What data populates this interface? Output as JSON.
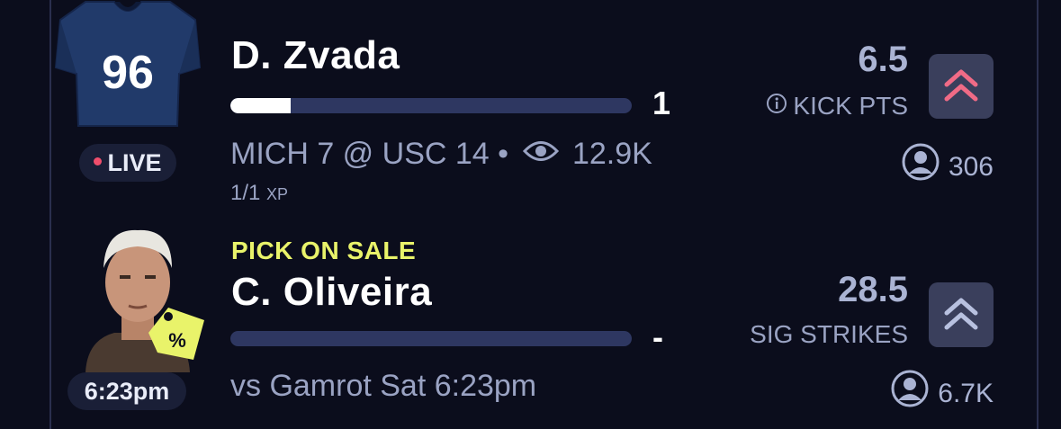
{
  "colors": {
    "background": "#0b0d1c",
    "promo": "#e9f36a",
    "live_dot": "#f04e6c",
    "arrow_active": "#f06b86",
    "arrow_inactive": "#b8c1e0",
    "progress_fill": "#ffffff",
    "progress_track": "#2e3761"
  },
  "cards": [
    {
      "player": "D. Zvada",
      "jersey_number": "96",
      "status_badge": "LIVE",
      "progress": 0.15,
      "current_value": "1",
      "game_info": "MICH 7 @ USC 14 •",
      "views": "12.9K",
      "sub_stat": "1/1",
      "sub_stat_unit": "XP",
      "line": "6.5",
      "stat_type": "KICK PTS",
      "pick_count": "306",
      "icons": [
        "jersey-icon",
        "eye-icon",
        "info-icon",
        "double-chevron-up-icon",
        "user-icon"
      ]
    },
    {
      "promo_label": "PICK ON SALE",
      "player": "C. Oliveira",
      "time_badge": "6:23pm",
      "progress": 0,
      "current_value": "-",
      "matchup": "vs Gamrot Sat 6:23pm",
      "line": "28.5",
      "stat_type": "SIG STRIKES",
      "pick_count": "6.7K",
      "icons": [
        "player-photo",
        "sale-tag-icon",
        "double-chevron-up-icon",
        "user-icon"
      ]
    }
  ]
}
